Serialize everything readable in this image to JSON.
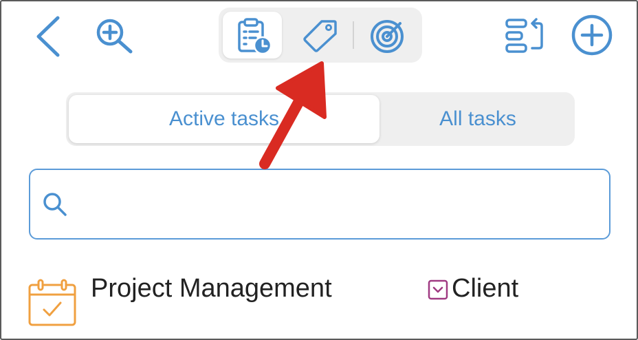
{
  "toolbar": {
    "back_icon": "chevron-left-icon",
    "zoom_icon": "zoom-in-icon",
    "view_icons": [
      "clipboard-clock-icon",
      "tag-icon",
      "target-icon"
    ],
    "selected_view": "clipboard-clock-icon",
    "sort_icon": "sort-list-icon",
    "add_icon": "plus-circle-icon"
  },
  "task_filter": {
    "active_label": "Active tasks",
    "all_label": "All tasks",
    "selected": "Active tasks"
  },
  "search": {
    "placeholder": "",
    "value": ""
  },
  "list": {
    "items": [
      {
        "title": "Project Management",
        "tag": "Client",
        "icon": "calendar-check-icon",
        "tag_icon": "checkbox-icon"
      }
    ]
  },
  "annotation": {
    "type": "red-arrow",
    "points_to": "tag-icon"
  },
  "colors": {
    "accent": "#4a90d0",
    "arrow": "#d92b22",
    "calendar": "#f0a040",
    "tag_purple": "#a03a82",
    "segment_bg": "#efefef"
  }
}
